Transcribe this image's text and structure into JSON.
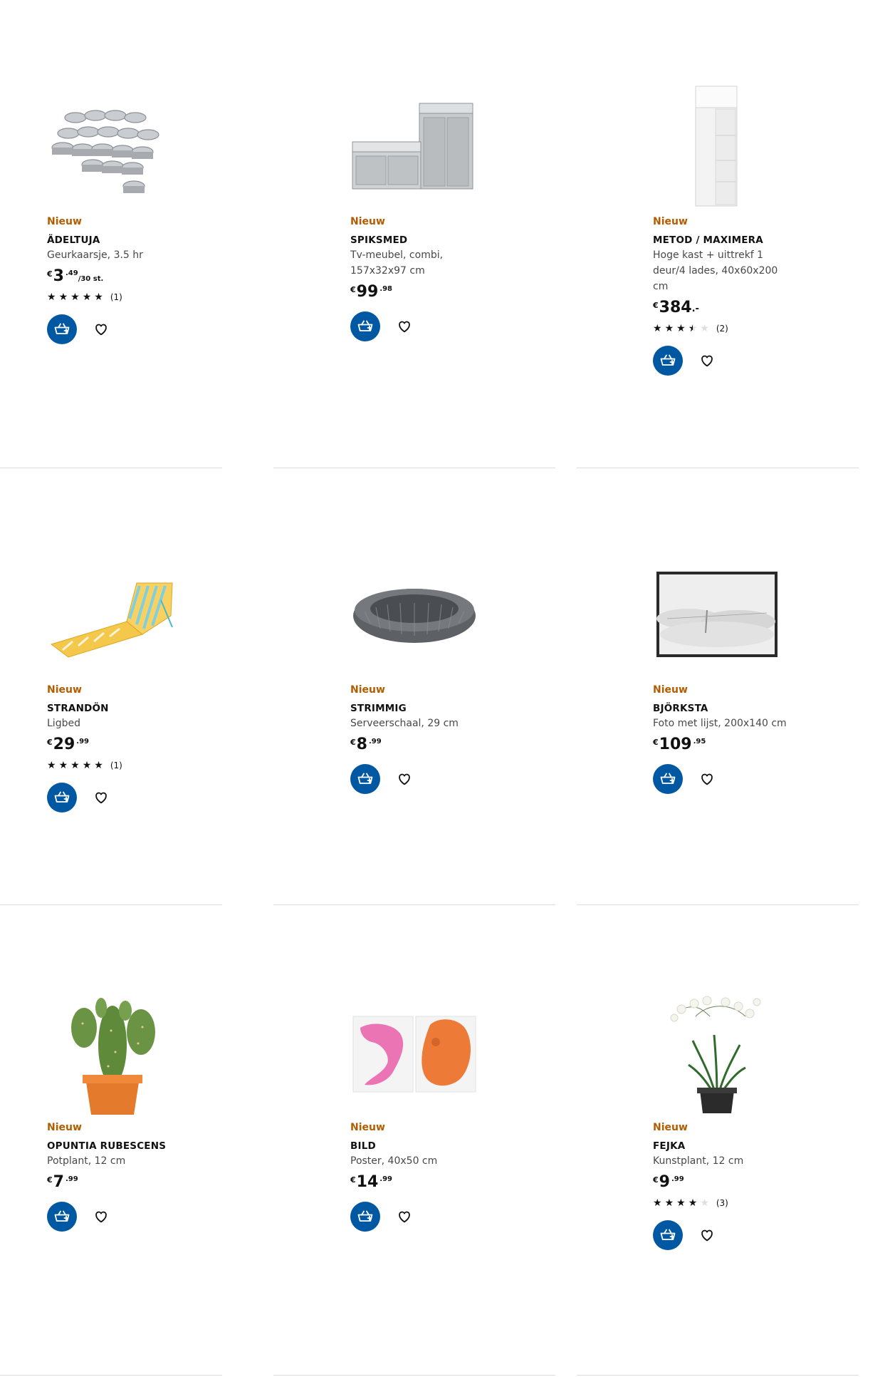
{
  "products": [
    {
      "badge": "Nieuw",
      "name": "ÄDELTUJA",
      "description": "Geurkaarsje, 3.5 hr",
      "price": {
        "currency": "€",
        "integer": "3",
        "decimal": ".49",
        "unit": "/30 st."
      },
      "rating": {
        "stars": 5,
        "count": "(1)"
      },
      "image": "tealight-candles-image"
    },
    {
      "badge": "Nieuw",
      "name": "SPIKSMED",
      "description": "Tv-meubel, combi, 157x32x97 cm",
      "price": {
        "currency": "€",
        "integer": "99",
        "decimal": ".98",
        "unit": ""
      },
      "rating": null,
      "image": "tv-cabinet-image"
    },
    {
      "badge": "Nieuw",
      "name": "METOD / MAXIMERA",
      "description": "Hoge kast + uittrekf 1 deur/4 lades, 40x60x200 cm",
      "price": {
        "currency": "€",
        "integer": "384",
        "decimal": ".-",
        "unit": ""
      },
      "rating": {
        "stars": 3.5,
        "count": "(2)"
      },
      "image": "tall-cabinet-image"
    },
    {
      "badge": "Nieuw",
      "name": "STRANDÖN",
      "description": "Ligbed",
      "price": {
        "currency": "€",
        "integer": "29",
        "decimal": ".99",
        "unit": ""
      },
      "rating": {
        "stars": 5,
        "count": "(1)"
      },
      "image": "beach-lounger-image"
    },
    {
      "badge": "Nieuw",
      "name": "STRIMMIG",
      "description": "Serveerschaal, 29 cm",
      "price": {
        "currency": "€",
        "integer": "8",
        "decimal": ".99",
        "unit": ""
      },
      "rating": null,
      "image": "serving-bowl-image"
    },
    {
      "badge": "Nieuw",
      "name": "BJÖRKSTA",
      "description": "Foto met lijst, 200x140 cm",
      "price": {
        "currency": "€",
        "integer": "109",
        "decimal": ".95",
        "unit": ""
      },
      "rating": null,
      "image": "framed-photo-image"
    },
    {
      "badge": "Nieuw",
      "name": "OPUNTIA RUBESCENS",
      "description": "Potplant, 12 cm",
      "price": {
        "currency": "€",
        "integer": "7",
        "decimal": ".99",
        "unit": ""
      },
      "rating": null,
      "image": "cactus-plant-image"
    },
    {
      "badge": "Nieuw",
      "name": "BILD",
      "description": "Poster, 40x50 cm",
      "price": {
        "currency": "€",
        "integer": "14",
        "decimal": ".99",
        "unit": ""
      },
      "rating": null,
      "image": "cat-poster-image"
    },
    {
      "badge": "Nieuw",
      "name": "FEJKA",
      "description": "Kunstplant, 12 cm",
      "price": {
        "currency": "€",
        "integer": "9",
        "decimal": ".99",
        "unit": ""
      },
      "rating": {
        "stars": 4,
        "count": "(3)"
      },
      "image": "orchid-plant-image"
    }
  ],
  "colors": {
    "badge": "#b35c00",
    "cart_button": "#0058a3",
    "divider": "#dcdcdc"
  },
  "icons": {
    "cart": "add-to-cart-icon",
    "favourite": "heart-icon",
    "star": "star-icon"
  }
}
